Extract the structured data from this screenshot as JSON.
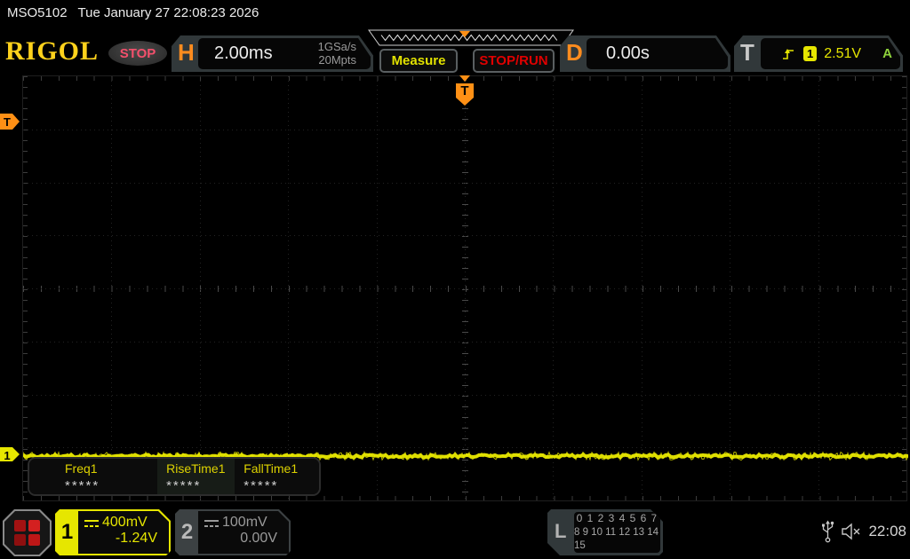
{
  "colors": {
    "gold": "#ffd21c",
    "orange": "#ff8c1e",
    "ch1": "#e6e600",
    "trig-orange": "#ff9015"
  },
  "top_bar": {
    "model": "MSO5102",
    "datetime": "Tue January 27 22:08:23 2026"
  },
  "header": {
    "logo": "RIGOL",
    "run_state": "STOP",
    "horizontal": {
      "label": "H",
      "timebase": "2.00ms",
      "sample_rate": "1GSa/s",
      "memory_depth": "20Mpts"
    },
    "measure_label": "Measure",
    "stop_run_label": "STOP/RUN",
    "delay": {
      "label": "D",
      "value": "0.00s"
    },
    "trigger": {
      "label": "T",
      "source_channel": "1",
      "level": "2.51V",
      "mode": "A"
    }
  },
  "graticule": {
    "trigger_position_label": "T",
    "trigger_level_label": "T",
    "channel1_marker": "1"
  },
  "measurements": {
    "items": [
      {
        "label": "Freq1",
        "value": "*****"
      },
      {
        "label": "RiseTime1",
        "value": "*****"
      },
      {
        "label": "FallTime1",
        "value": "*****"
      }
    ]
  },
  "bottom_bar": {
    "channels": [
      {
        "number": "1",
        "scale": "400mV",
        "offset": "-1.24V"
      },
      {
        "number": "2",
        "scale": "100mV",
        "offset": "0.00V"
      }
    ],
    "digital": {
      "label": "L",
      "row1": "0 1 2 3  4 5 6 7",
      "row2": "8 9 10 11 12 13 14 15"
    },
    "clock": "22:08"
  },
  "icons": {
    "menu": "red-grid-icon",
    "usb": "usb-icon",
    "audio": "speaker-muted-icon",
    "coupling": "dc-coupling-icon",
    "trigger_slope": "rising-edge-icon"
  }
}
